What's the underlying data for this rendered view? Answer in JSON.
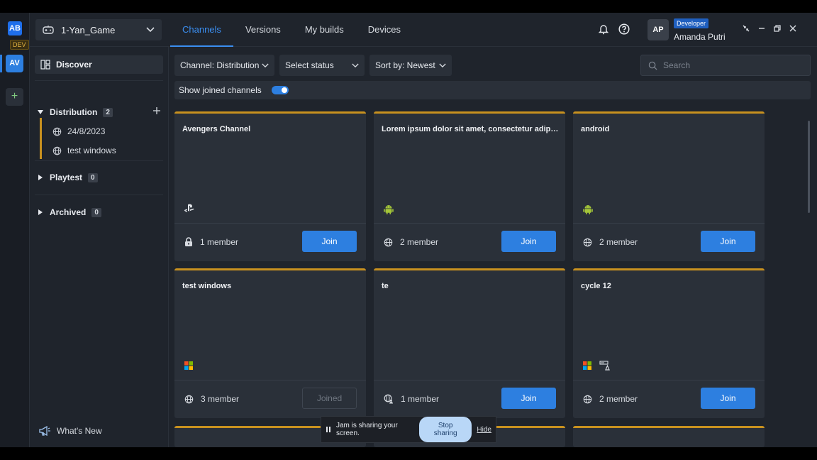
{
  "rail": {
    "logo": "AB",
    "env_tag": "DEV",
    "active_workspace": "AV",
    "add_label": "+"
  },
  "topbar": {
    "game_name": "1-Yan_Game",
    "tabs": [
      {
        "label": "Channels",
        "active": true
      },
      {
        "label": "Versions",
        "active": false
      },
      {
        "label": "My builds",
        "active": false
      },
      {
        "label": "Devices",
        "active": false
      }
    ],
    "user": {
      "initials": "AP",
      "role": "Developer",
      "name": "Amanda Putri"
    }
  },
  "sidebar": {
    "discover_label": "Discover",
    "groups": [
      {
        "label": "Distribution",
        "count": "2",
        "expanded": true,
        "items": [
          {
            "label": "24/8/2023"
          },
          {
            "label": "test windows"
          }
        ]
      },
      {
        "label": "Playtest",
        "count": "0",
        "expanded": false
      },
      {
        "label": "Archived",
        "count": "0",
        "expanded": false
      }
    ],
    "whats_new_label": "What's New"
  },
  "filters": {
    "channel": "Channel: Distribution",
    "status": "Select status",
    "sort": "Sort by: Newest",
    "search_placeholder": "Search",
    "search_value": "",
    "show_joined_label": "Show joined channels",
    "show_joined_on": true
  },
  "cards": [
    {
      "title": "Avengers Channel",
      "platforms": [
        "playstation-icon"
      ],
      "privacy": "lock-icon",
      "members": "1 member",
      "action": "Join"
    },
    {
      "title": "Lorem ipsum dolor sit amet, consectetur adipiscing elit",
      "platforms": [
        "android-icon"
      ],
      "privacy": "globe-icon",
      "members": "2 member",
      "action": "Join"
    },
    {
      "title": "android",
      "platforms": [
        "android-icon"
      ],
      "privacy": "globe-icon",
      "members": "2 member",
      "action": "Join"
    },
    {
      "title": "test windows",
      "platforms": [
        "windows-icon"
      ],
      "privacy": "globe-icon",
      "members": "3 member",
      "action": "Joined"
    },
    {
      "title": "te",
      "platforms": [],
      "privacy": "globe-person-icon",
      "members": "1 member",
      "action": "Join"
    },
    {
      "title": "cycle 12",
      "platforms": [
        "windows-icon",
        "steam-deck-icon"
      ],
      "privacy": "globe-icon",
      "members": "2 member",
      "action": "Join"
    }
  ],
  "jam": {
    "message": "Jam is sharing your screen.",
    "stop_label": "Stop sharing",
    "hide_label": "Hide"
  },
  "colors": {
    "accent": "#2d7fe0",
    "card_border": "#c8911f",
    "background": "#1f242c"
  }
}
